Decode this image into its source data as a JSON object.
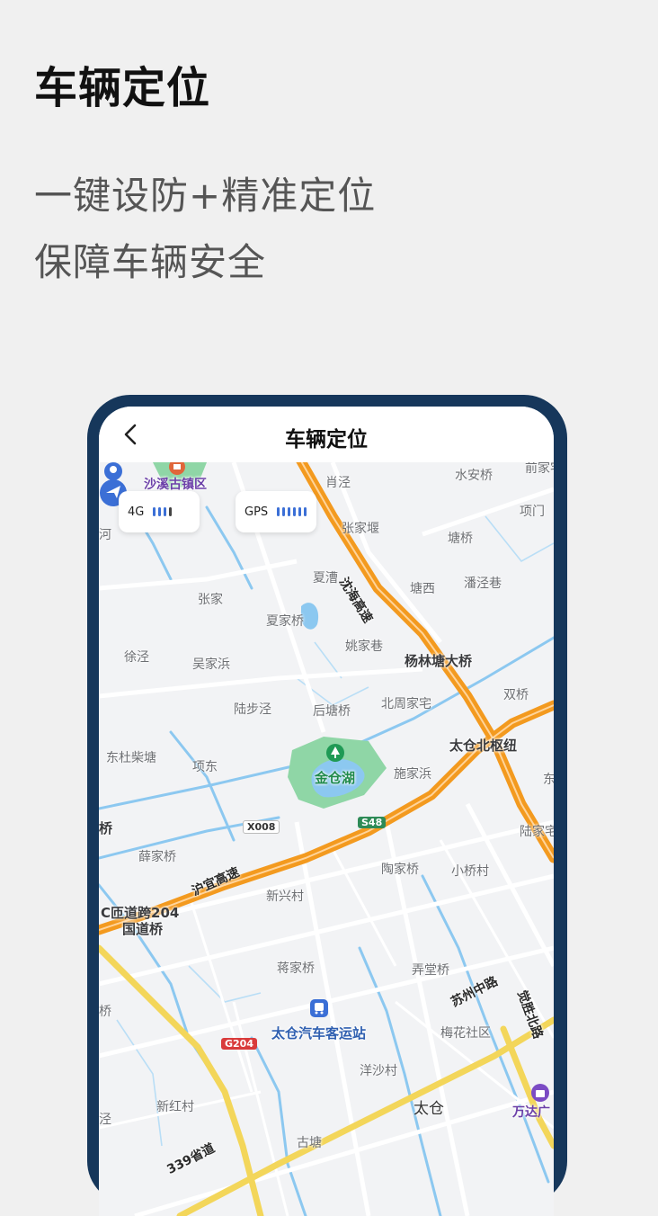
{
  "header": {
    "title": "车辆定位"
  },
  "subtitle": {
    "line1": "一键设防+精准定位",
    "line2": "保障车辆安全"
  },
  "phone": {
    "nav_title": "车辆定位",
    "status_chips": [
      {
        "label": "4G",
        "bars": 4,
        "strong_bars": 3
      },
      {
        "label": "GPS",
        "bars": 6,
        "strong_bars": 6
      }
    ]
  },
  "map_labels": {
    "shaxi": "沙溪古镇区",
    "xiaojing": "肖泾",
    "shuianqiao": "水安桥",
    "qianjia": "前家宅",
    "xiangmen": "项门",
    "he": "河",
    "zhangjiayan": "张家堰",
    "tangqiao": "塘桥",
    "xiacao": "夏漕",
    "tangxi": "塘西",
    "panjingxiang": "潘泾巷",
    "zhangjia": "张家",
    "xiajiaqiao": "夏家桥",
    "yaojiaxiang": "姚家巷",
    "xujing": "徐泾",
    "wujiabang": "吴家浜",
    "yanglintang": "杨林塘大桥",
    "shuangqiao": "双桥",
    "lubujing": "陆步泾",
    "houtangqiao": "后塘桥",
    "beizhoujia": "北周家宅",
    "dongduchai": "东杜柴塘",
    "xiangdong": "项东",
    "jincanghu": "金仓湖",
    "shijiabang": "施家浜",
    "taicangbei": "太仓北枢纽",
    "dong": "东",
    "qiao": "桥",
    "lujiazhai": "陆家宅",
    "xuejiaqiao": "薛家桥",
    "taojiaqiao": "陶家桥",
    "xiaoqiaocun": "小桥村",
    "xinxingcun": "新兴村",
    "roadsign": "C匝道跨204",
    "guodaoqiao": "国道桥",
    "jiangjiaqiao": "蒋家桥",
    "nongtangqiao": "弄堂桥",
    "taicangqiche": "太仓汽车客运站",
    "meihua": "梅花社区",
    "yangshacun": "洋沙村",
    "xinhongcun": "新红村",
    "taicang": "太仓",
    "wanda": "万达广",
    "gutang": "古塘",
    "jing": "泾",
    "jiao": "桥",
    "yanhai_road": "沈海高速",
    "huyi_road": "沪宜高速",
    "suzhou_road": "苏州中路",
    "province_road": "339省道",
    "jueshen_road": "觉胜北路",
    "x008": "X008",
    "s48": "S48",
    "g204": "G204"
  },
  "colors": {
    "frame": "#16375b",
    "highway": "#f39a1f",
    "arterial": "#f3d65a",
    "water": "#8cc8f0",
    "park": "#8fd6a6",
    "accent": "#3b6fd6"
  }
}
